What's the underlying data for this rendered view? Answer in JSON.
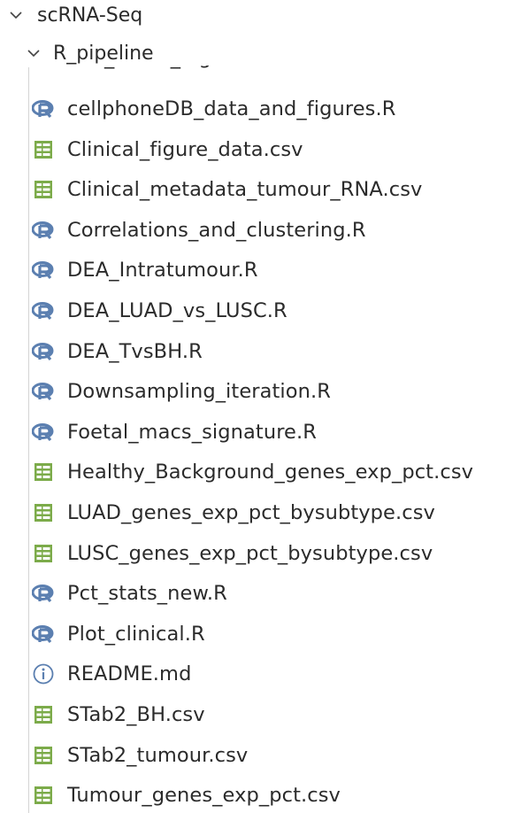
{
  "tree": {
    "root_folder": "scRNA-Seq",
    "sub_folder": "R_pipeline",
    "partial_item": "Cell_count_bigPlot.R",
    "files": [
      {
        "name": "cellphoneDB_data_and_figures.R",
        "icon": "r-file-icon"
      },
      {
        "name": "Clinical_figure_data.csv",
        "icon": "csv-file-icon"
      },
      {
        "name": "Clinical_metadata_tumour_RNA.csv",
        "icon": "csv-file-icon"
      },
      {
        "name": "Correlations_and_clustering.R",
        "icon": "r-file-icon"
      },
      {
        "name": "DEA_Intratumour.R",
        "icon": "r-file-icon"
      },
      {
        "name": "DEA_LUAD_vs_LUSC.R",
        "icon": "r-file-icon"
      },
      {
        "name": "DEA_TvsBH.R",
        "icon": "r-file-icon"
      },
      {
        "name": "Downsampling_iteration.R",
        "icon": "r-file-icon"
      },
      {
        "name": "Foetal_macs_signature.R",
        "icon": "r-file-icon"
      },
      {
        "name": "Healthy_Background_genes_exp_pct.csv",
        "icon": "csv-file-icon"
      },
      {
        "name": "LUAD_genes_exp_pct_bysubtype.csv",
        "icon": "csv-file-icon"
      },
      {
        "name": "LUSC_genes_exp_pct_bysubtype.csv",
        "icon": "csv-file-icon"
      },
      {
        "name": "Pct_stats_new.R",
        "icon": "r-file-icon"
      },
      {
        "name": "Plot_clinical.R",
        "icon": "r-file-icon"
      },
      {
        "name": "README.md",
        "icon": "info-icon"
      },
      {
        "name": "STab2_BH.csv",
        "icon": "csv-file-icon"
      },
      {
        "name": "STab2_tumour.csv",
        "icon": "csv-file-icon"
      },
      {
        "name": "Tumour_genes_exp_pct.csv",
        "icon": "csv-file-icon"
      }
    ]
  },
  "colors": {
    "r_icon": "#5b7fb0",
    "csv_icon": "#7cab4a",
    "info_icon": "#5b7fb0",
    "text": "#2b2b2b",
    "chevron": "#444444",
    "guide": "#d4d4d4"
  }
}
